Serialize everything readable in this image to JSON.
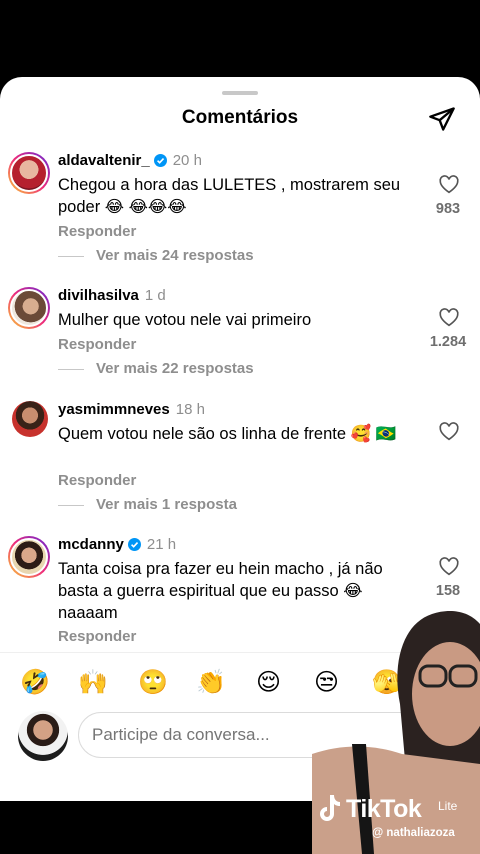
{
  "sheet": {
    "title": "Comentários",
    "share_icon": "send-icon"
  },
  "comments": [
    {
      "username": "aldavaltenir_",
      "verified": true,
      "time": "20 h",
      "text": "Chegou a hora das LULETES , mostrarem seu poder 😂 😂😂😂",
      "reply": "Responder",
      "more": "Ver mais 24 respostas",
      "likes": "983"
    },
    {
      "username": "divilhasilva",
      "verified": false,
      "time": "1 d",
      "text": "Mulher que votou nele vai primeiro",
      "reply": "Responder",
      "more": "Ver mais 22 respostas",
      "likes": "1.284"
    },
    {
      "username": "yasmimmneves",
      "verified": false,
      "time": "18 h",
      "text": "Quem votou nele são os linha de frente 🥰 🇧🇷",
      "reply": "Responder",
      "more": "Ver mais 1 resposta",
      "likes": ""
    },
    {
      "username": "mcdanny",
      "verified": true,
      "time": "21 h",
      "text": "Tanta coisa pra fazer eu hein  macho , já não basta a guerra espiritual que eu passo 😂 naaaam",
      "reply": "Responder",
      "more": "",
      "likes": "158"
    }
  ],
  "emoji_bar": [
    "🤣",
    "🙌",
    "🙄",
    "👏",
    "😌",
    "😒",
    "🫣"
  ],
  "composer": {
    "placeholder": "Participe da conversa..."
  },
  "watermark": {
    "logo": "TikTok",
    "suffix": "Lite",
    "handle": "@ nathaliazoza"
  },
  "colors": {
    "sheet_bg": "#ffffff",
    "muted_text": "#8e8e8e",
    "verified_blue": "#0095f6",
    "avatar_ring": "#ee2a7b"
  }
}
